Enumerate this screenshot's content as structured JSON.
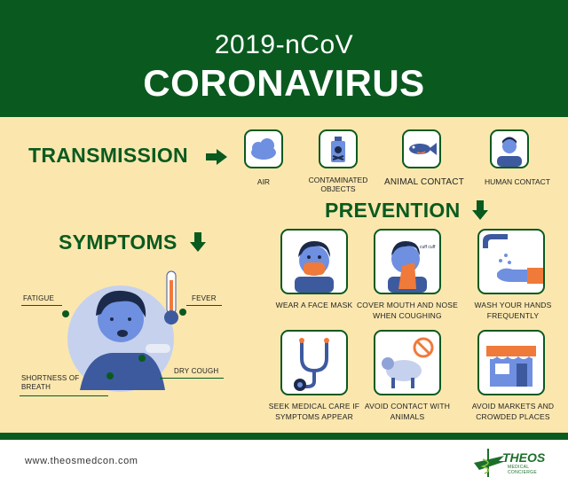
{
  "header": {
    "subtitle": "2019-nCoV",
    "title": "CORONAVIRUS"
  },
  "transmission": {
    "heading": "TRANSMISSION",
    "items": [
      {
        "label": "AIR",
        "icon": "cloud-icon"
      },
      {
        "label": "CONTAMINATED OBJECTS",
        "icon": "poison-bottle-icon"
      },
      {
        "label": "ANIMAL CONTACT",
        "icon": "fish-icon"
      },
      {
        "label": "HUMAN CONTACT",
        "icon": "person-icon"
      }
    ]
  },
  "prevention": {
    "heading": "PREVENTION",
    "items": [
      {
        "label": "WEAR A FACE MASK",
        "icon": "face-mask-icon"
      },
      {
        "label": "COVER MOUTH AND NOSE WHEN COUGHING",
        "icon": "cough-cover-icon"
      },
      {
        "label": "WASH YOUR HANDS FREQUENTLY",
        "icon": "hand-wash-icon"
      },
      {
        "label": "SEEK MEDICAL CARE IF SYMPTOMS APPEAR",
        "icon": "stethoscope-icon"
      },
      {
        "label": "AVOID CONTACT WITH ANIMALS",
        "icon": "no-animal-icon"
      },
      {
        "label": "AVOID MARKETS AND CROWDED PLACES",
        "icon": "market-icon"
      }
    ]
  },
  "symptoms": {
    "heading": "SYMPTOMS",
    "items": [
      {
        "label": "FATIGUE"
      },
      {
        "label": "FEVER"
      },
      {
        "label": "SHORTNESS OF BREATH"
      },
      {
        "label": "DRY COUGH"
      }
    ],
    "cough_text": "cuff cuff"
  },
  "footer": {
    "url": "www.theosmedcon.com",
    "brand": "THEOS",
    "tagline": "MEDICAL CONCIERGE"
  },
  "colors": {
    "green": "#0a5a1f",
    "panel": "#fbe7ae",
    "accent": "#f07a3a",
    "skin_blue": "#3d5a9f"
  }
}
